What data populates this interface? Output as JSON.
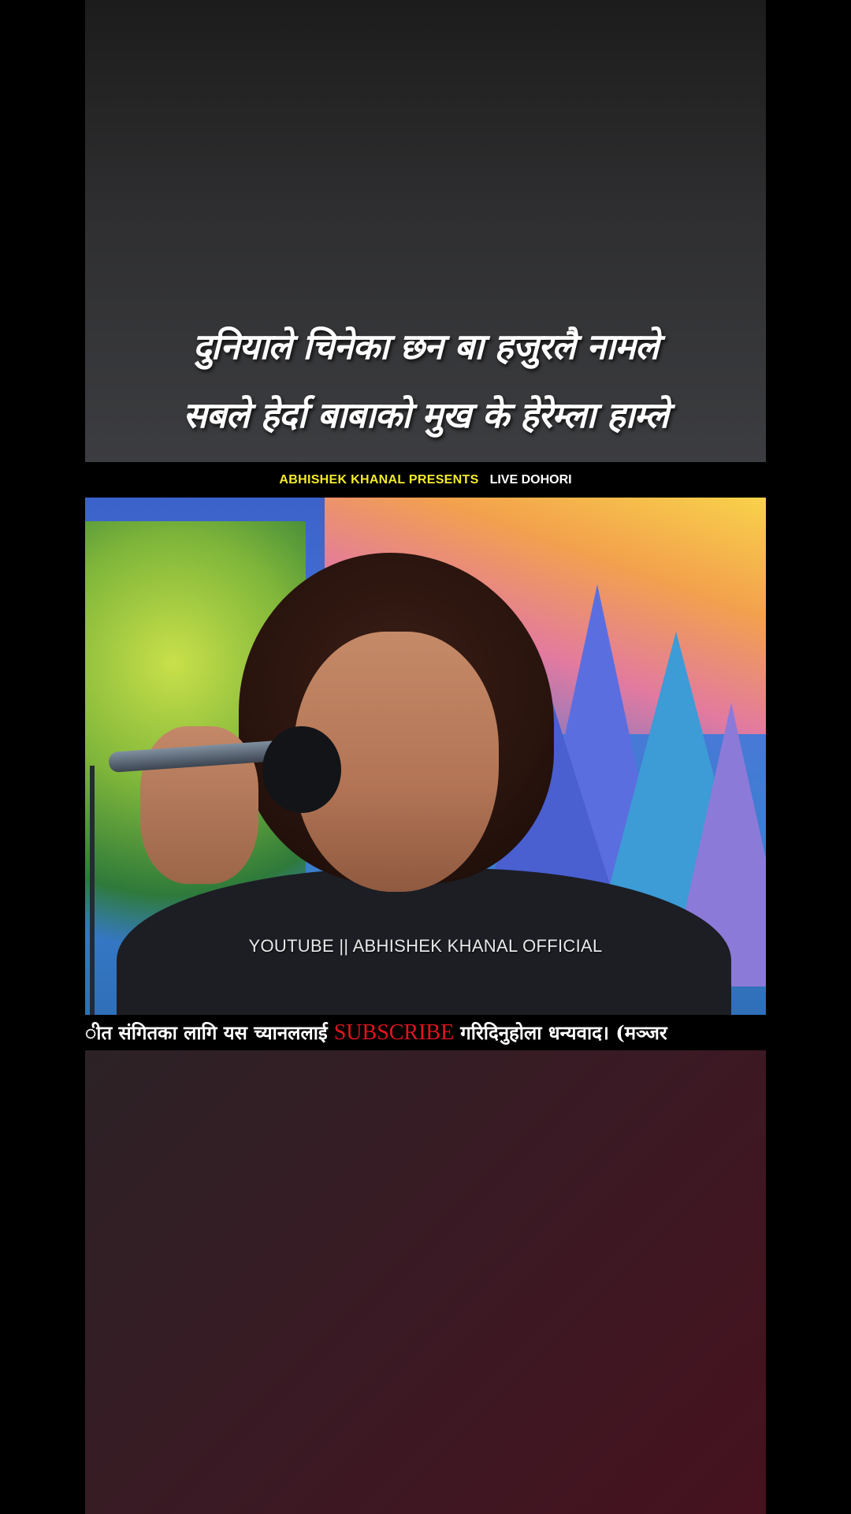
{
  "lyrics": {
    "line1": "दुनियाले चिनेका छन बा हजुरलै नामले",
    "line2": "सबले हेर्दा बाबाको मुख के हेरेम्ला हाम्ले"
  },
  "header": {
    "presents": "ABHISHEK KHANAL PRESENTS",
    "live": "LIVE DOHORI"
  },
  "video": {
    "watermark": "YOUTUBE || ABHISHEK KHANAL OFFICIAL"
  },
  "ticker": {
    "before": "ीत संगितका लागि यस च्यानललाई",
    "subscribe": "SUBSCRIBE",
    "after": "गरिदिनुहोला धन्यवाद। (मञ्जर"
  },
  "colors": {
    "presents": "#f4ea2a",
    "subscribe": "#e0141c",
    "background": "#000000"
  }
}
